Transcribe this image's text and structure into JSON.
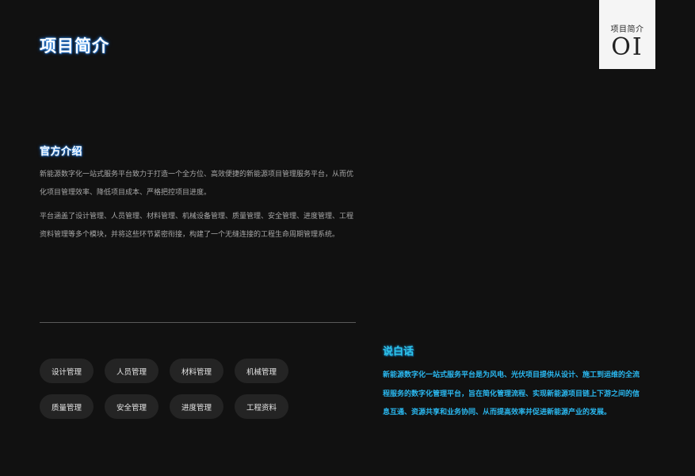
{
  "badge": {
    "label": "项目简介",
    "number": "OI"
  },
  "page": {
    "title": "项目简介"
  },
  "official_intro": {
    "title": "官方介绍",
    "paragraphs": [
      "新能源数字化一站式服务平台致力于打造一个全方位、高效便捷的新能源项目管理服务平台，从而优化项目管理效率、降低项目成本、严格把控项目进度。",
      "平台涵盖了设计管理、人员管理、材料管理、机械设备管理、质量管理、安全管理、进度管理、工程资料管理等多个模块，并将这些环节紧密衔接，构建了一个无缝连接的工程生命周期管理系统。"
    ]
  },
  "modules": [
    "设计管理",
    "人员管理",
    "材料管理",
    "机械管理",
    "质量管理",
    "安全管理",
    "进度管理",
    "工程资料"
  ],
  "plain_talk": {
    "title": "说白话",
    "text": "新能源数字化一站式服务平台是为风电、光伏项目提供从设计、施工到运维的全流程服务的数字化管理平台，旨在简化管理流程、实现新能源项目链上下游之间的信息互通、资源共享和业务协同、从而提高效率并促进新能源产业的发展。"
  },
  "colors": {
    "background": "#111111",
    "accent_blue": "#2ab8f0",
    "pill_background": "#242424"
  }
}
